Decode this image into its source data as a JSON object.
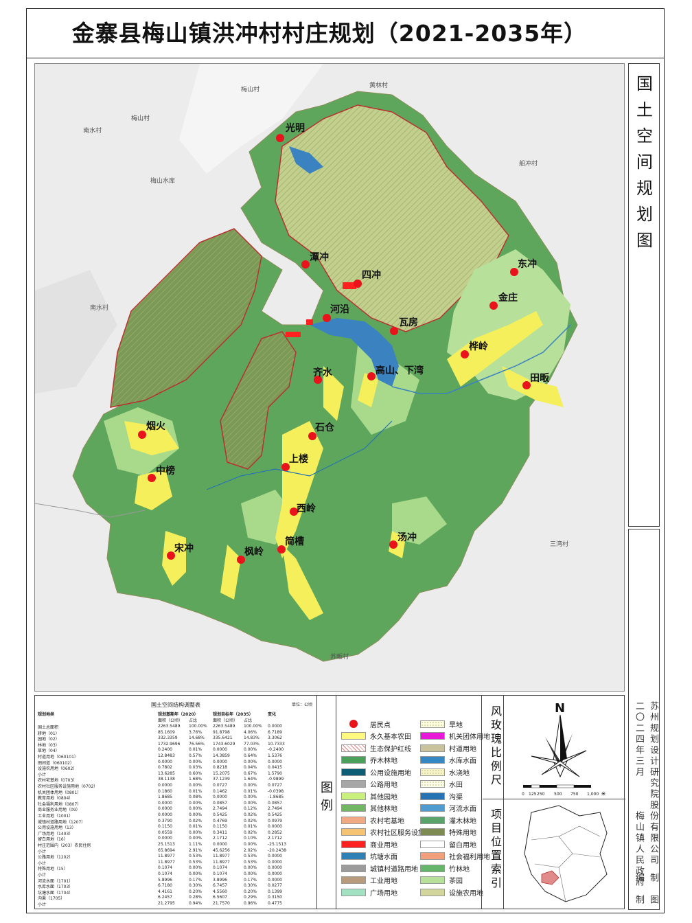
{
  "title": "金寨县梅山镇洪冲村村庄规划（2021-2035年）",
  "side_title": [
    "国",
    "土",
    "空",
    "间",
    "规",
    "划",
    "图"
  ],
  "side_credits": {
    "designer": "苏州规划设计研究院股份有限公司",
    "date": "二〇二四年三月",
    "client": "梅山镇人民政府",
    "made": "编　制",
    "drawn": "制　图"
  },
  "villages": [
    "光明",
    "潭冲",
    "四冲",
    "河沿",
    "瓦房",
    "东冲",
    "金庄",
    "桦岭",
    "田畈",
    "齐水",
    "高山、下湾",
    "烟火",
    "石仓",
    "上楼",
    "中榜",
    "西岭",
    "宋冲",
    "枫岭",
    "简槽",
    "汤冲"
  ],
  "neighbors": [
    "梅山村",
    "黄林村",
    "梅山村",
    "南水村",
    "梅山水库",
    "船冲村",
    "南水村",
    "三湾村",
    "苏畈村"
  ],
  "table": {
    "title": "国土空间结构调整表",
    "unit": "单位：公顷",
    "headers": [
      "规划地类",
      "规划基期年（2020）",
      "规划目标年（2035）",
      "变化"
    ],
    "subheaders": [
      "面积（公顷）",
      "占比",
      "面积（公顷）",
      "占比"
    ],
    "rows": [
      [
        "国土总面积",
        "2263.5489",
        "100.00%",
        "2263.5489",
        "100.00%",
        "0.0000"
      ],
      [
        "耕地（01）",
        "85.1609",
        "3.76%",
        "91.8798",
        "4.06%",
        "6.7189"
      ],
      [
        "园地（02）",
        "332.3359",
        "14.68%",
        "335.6421",
        "14.83%",
        "3.3062"
      ],
      [
        "林地（03）",
        "1732.9696",
        "76.56%",
        "1743.6029",
        "77.03%",
        "10.7333"
      ],
      [
        "草地（04）",
        "0.2400",
        "0.01%",
        "0.0000",
        "0.00%",
        "-0.2400"
      ],
      [
        "村道用地（060101）",
        "12.8483",
        "0.57%",
        "14.3859",
        "0.64%",
        "1.5376"
      ],
      [
        "田间道（060102）",
        "0.0000",
        "0.00%",
        "0.0000",
        "0.00%",
        "0.0000"
      ],
      [
        "设施农用地（0602）",
        "0.7802",
        "0.03%",
        "0.8218",
        "0.04%",
        "0.0415"
      ],
      [
        "小计",
        "13.6285",
        "0.60%",
        "15.2075",
        "0.67%",
        "1.5790"
      ],
      [
        "农村宅基地（0703）",
        "38.1138",
        "1.68%",
        "37.1239",
        "1.64%",
        "-0.9899"
      ],
      [
        "农村社区服务设施用地（0702）",
        "0.0000",
        "0.00%",
        "0.0727",
        "0.00%",
        "0.0727"
      ],
      [
        "机关团体用地（0801）",
        "0.1860",
        "0.01%",
        "0.1462",
        "0.01%",
        "-0.0398"
      ],
      [
        "教育用地（0804）",
        "1.8685",
        "0.08%",
        "0.0000",
        "0.00%",
        "-1.8685"
      ],
      [
        "社会福利用地（0807）",
        "0.0000",
        "0.00%",
        "0.0857",
        "0.00%",
        "0.0857"
      ],
      [
        "商业服务业用地（09）",
        "0.0000",
        "0.00%",
        "2.7494",
        "0.12%",
        "2.7494"
      ],
      [
        "工业用地（1001）",
        "0.0000",
        "0.00%",
        "0.5425",
        "0.02%",
        "0.5425"
      ],
      [
        "城镇村道路用地（1207）",
        "0.3790",
        "0.02%",
        "0.4769",
        "0.02%",
        "0.0979"
      ],
      [
        "公用设施用地（13）",
        "0.1150",
        "0.01%",
        "0.1150",
        "0.01%",
        "0.0000"
      ],
      [
        "广场用地（1403）",
        "0.0559",
        "0.00%",
        "0.3411",
        "0.02%",
        "0.2852"
      ],
      [
        "留白用地（16）",
        "0.0000",
        "0.00%",
        "2.1712",
        "0.10%",
        "2.1712"
      ],
      [
        "村庄范围内（203）农民住房",
        "25.1513",
        "1.11%",
        "0.0000",
        "0.00%",
        "-25.1513"
      ],
      [
        "小计",
        "65.8694",
        "2.91%",
        "45.6256",
        "2.02%",
        "-20.2438"
      ],
      [
        "公路用地（1202）",
        "11.8977",
        "0.53%",
        "11.8977",
        "0.53%",
        "0.0000"
      ],
      [
        "小计",
        "11.8977",
        "0.53%",
        "11.8977",
        "0.53%",
        "0.0000"
      ],
      [
        "特殊用地（15）",
        "0.1074",
        "0.00%",
        "0.1074",
        "0.00%",
        "0.0000"
      ],
      [
        "小计",
        "0.1074",
        "0.00%",
        "0.1074",
        "0.00%",
        "0.0000"
      ],
      [
        "河流水面（1701）",
        "5.8996",
        "0.17%",
        "3.8996",
        "0.17%",
        "0.0000"
      ],
      [
        "水库水面（1703）",
        "6.7180",
        "0.30%",
        "6.7457",
        "0.30%",
        "0.0277"
      ],
      [
        "坑塘水面（1704）",
        "4.4161",
        "0.20%",
        "4.5560",
        "0.20%",
        "0.1399"
      ],
      [
        "沟渠（1705）",
        "6.2457",
        "0.28%",
        "6.5607",
        "0.29%",
        "0.3150"
      ],
      [
        "小计",
        "21.2795",
        "0.94%",
        "21.7570",
        "0.96%",
        "0.4775"
      ]
    ]
  },
  "legend_heading": "图　例",
  "legend": [
    {
      "label": "居民点",
      "color": "#e8131b",
      "kind": "dot"
    },
    {
      "label": "永久基本农田",
      "color": "#fff980"
    },
    {
      "label": "生态保护红线",
      "color": "#ffffff",
      "kind": "hatch-red"
    },
    {
      "label": "乔木林地",
      "color": "#4ca15a"
    },
    {
      "label": "公用设施用地",
      "color": "#0b5e74"
    },
    {
      "label": "公路用地",
      "color": "#a7a7a7"
    },
    {
      "label": "其他园地",
      "color": "#c9f07d"
    },
    {
      "label": "其他林地",
      "color": "#71b763"
    },
    {
      "label": "农村宅基地",
      "color": "#f0a982"
    },
    {
      "label": "农村社区服务设施用地",
      "color": "#f6c373"
    },
    {
      "label": "商业用地",
      "color": "#ff2020"
    },
    {
      "label": "坑塘水面",
      "color": "#2e80b5"
    },
    {
      "label": "城镇村道路用地",
      "color": "#9b9b9b"
    },
    {
      "label": "工业用地",
      "color": "#b89a7c"
    },
    {
      "label": "广场用地",
      "color": "#a2e2c2"
    },
    {
      "label": "旱地",
      "color": "#fbfbe0",
      "kind": "dots"
    },
    {
      "label": "机关团体用地",
      "color": "#e61ad6"
    },
    {
      "label": "村道用地",
      "color": "#c9c39d"
    },
    {
      "label": "水库水面",
      "color": "#3588c4"
    },
    {
      "label": "水浇地",
      "color": "#f7f3c8",
      "kind": "dots"
    },
    {
      "label": "水田",
      "color": "#fbfce9",
      "kind": "dots"
    },
    {
      "label": "沟渠",
      "color": "#2573b3"
    },
    {
      "label": "河流水面",
      "color": "#4e9bd1"
    },
    {
      "label": "灌木林地",
      "color": "#5aa36a"
    },
    {
      "label": "特殊用地",
      "color": "#7e8b52"
    },
    {
      "label": "留白用地",
      "color": "#ffffff"
    },
    {
      "label": "社会福利用地",
      "color": "#f2a07c"
    },
    {
      "label": "竹林地",
      "color": "#65b56b"
    },
    {
      "label": "茶园",
      "color": "#b7e09a"
    },
    {
      "label": "设施农用地",
      "color": "#d3d69c"
    }
  ],
  "compass_heading": "风玫瑰比例尺",
  "north": "N",
  "scale": {
    "ticks": [
      "0",
      "125",
      "250",
      "500",
      "750",
      "1,000"
    ],
    "unit": "米"
  },
  "location_heading": "项目位置索引",
  "colors": {
    "forest": "#5fa65d",
    "forest_dark": "#4e9450",
    "garden": "#b7e09a",
    "farmland": "#f4ef5b",
    "water": "#3b82c1",
    "eco": "#c5d79b",
    "redline": "#b8312f",
    "village": "#e8131b"
  }
}
